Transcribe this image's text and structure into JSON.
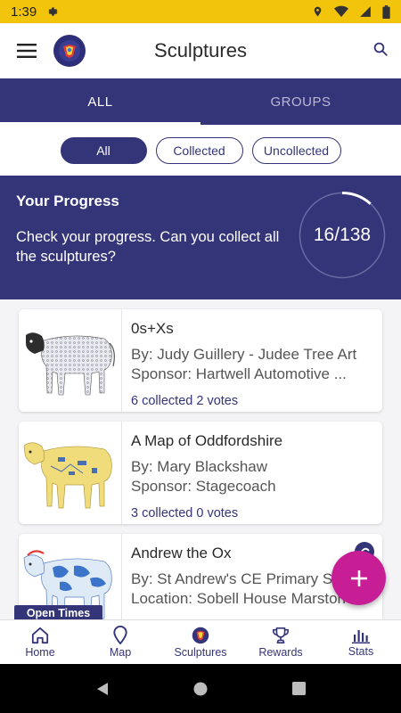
{
  "status_bar": {
    "time": "1:39"
  },
  "header": {
    "title": "Sculptures"
  },
  "tabs": [
    {
      "label": "ALL",
      "active": true
    },
    {
      "label": "GROUPS",
      "active": false
    }
  ],
  "filters": {
    "all": "All",
    "collected": "Collected",
    "uncollected": "Uncollected"
  },
  "progress": {
    "title": "Your Progress",
    "description": "Check your progress. Can you collect all the sculptures?",
    "count_text": "16/138",
    "collected": 16,
    "total": 138
  },
  "sculptures": [
    {
      "name": "0s+Xs",
      "line1": "By: Judy Guillery - Judee Tree Art",
      "line2": "Sponsor: Hartwell Automotive ...",
      "stats": "6 collected  2 votes"
    },
    {
      "name": "A Map of Oddfordshire",
      "line1": "By: Mary Blackshaw",
      "line2": "Sponsor: Stagecoach",
      "stats": "3 collected  0 votes"
    },
    {
      "name": "Andrew the Ox",
      "line1": "By: St Andrew's CE Primary S",
      "line2": "Location: Sobell House Marston"
    }
  ],
  "open_times_label": "Open Times",
  "bottom_nav": [
    {
      "label": "Home",
      "icon": "home-icon"
    },
    {
      "label": "Map",
      "icon": "map-pin-icon"
    },
    {
      "label": "Sculptures",
      "icon": "sculpture-logo-icon"
    },
    {
      "label": "Rewards",
      "icon": "trophy-icon"
    },
    {
      "label": "Stats",
      "icon": "bar-chart-icon"
    }
  ],
  "colors": {
    "primary": "#343479",
    "status_bar": "#f2c40b",
    "fab": "#c71d95"
  }
}
